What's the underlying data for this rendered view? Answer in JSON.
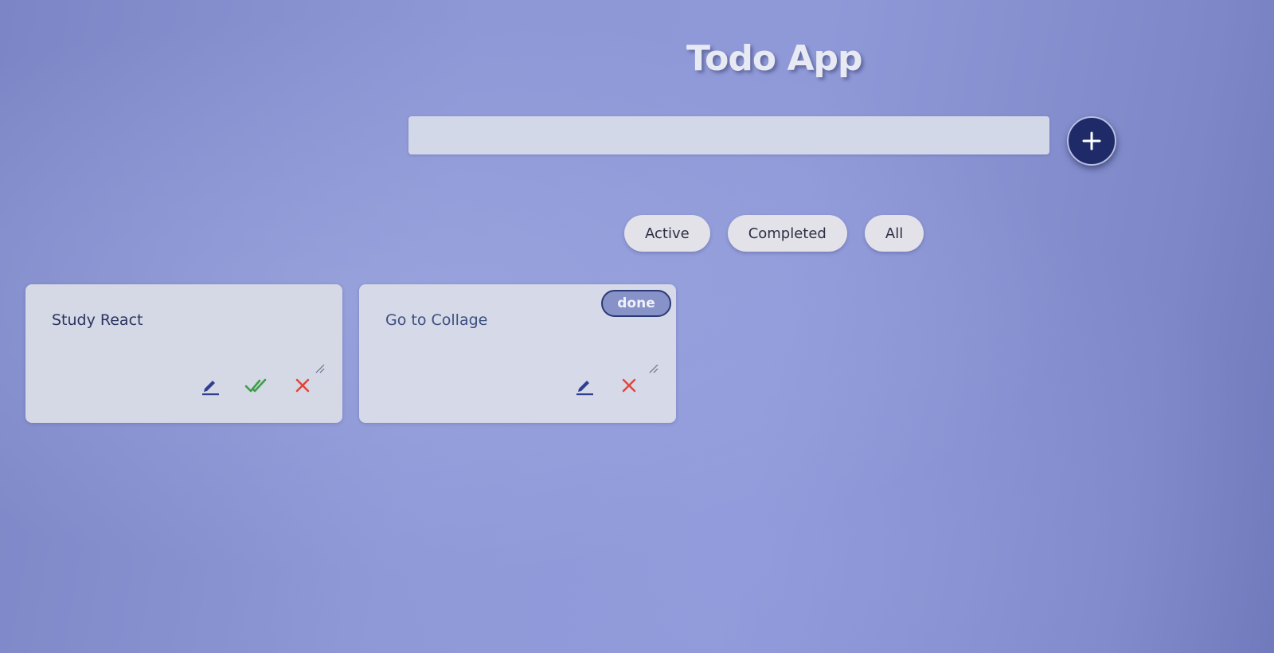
{
  "app": {
    "title": "Todo App"
  },
  "add_form": {
    "input_value": "",
    "input_placeholder": "",
    "add_button_icon": "plus-icon"
  },
  "filters": [
    {
      "label": "Active"
    },
    {
      "label": "Completed"
    },
    {
      "label": "All"
    }
  ],
  "todos": [
    {
      "text": "Study React",
      "completed": false,
      "actions": [
        "edit-icon",
        "double-check-icon",
        "close-icon"
      ]
    },
    {
      "text": "Go to Collage",
      "completed": true,
      "badge": "done",
      "actions": [
        "edit-icon",
        "close-icon"
      ]
    }
  ],
  "colors": {
    "accent": "#1f2a68",
    "edit_icon": "#2f3f8f",
    "check_icon": "#3aa043",
    "delete_icon": "#e0443a"
  }
}
